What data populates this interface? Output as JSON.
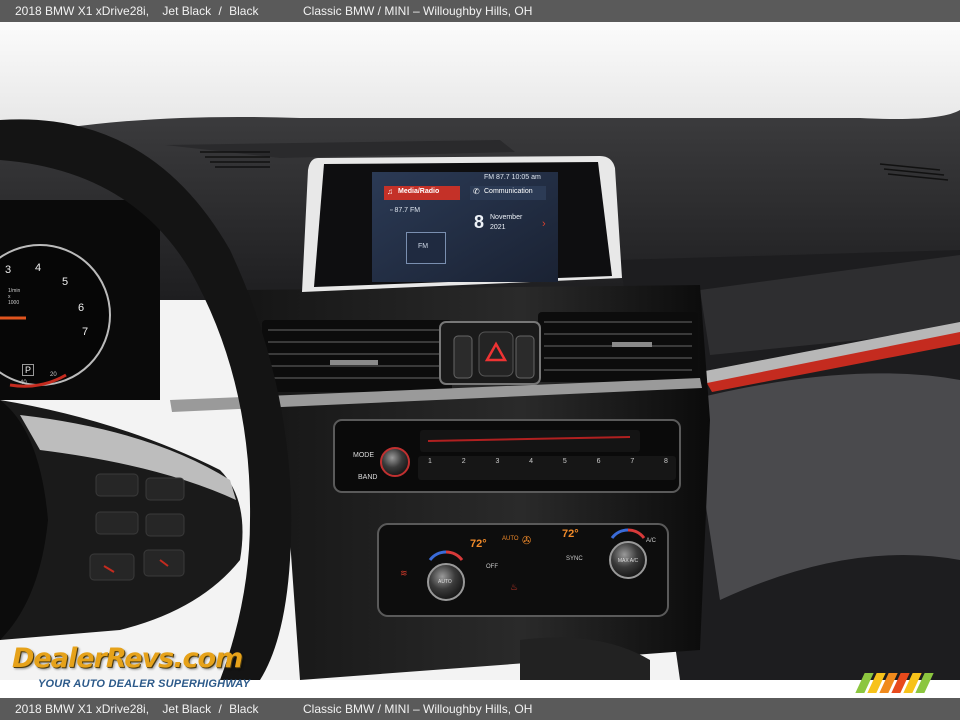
{
  "caption": {
    "model": "2018 BMW X1 xDrive28i,",
    "exterior": "Jet Black",
    "separator": "/",
    "interior": "Black",
    "dealer": "Classic BMW / MINI – Willoughby Hills, OH"
  },
  "watermark": {
    "brand": "DealerRevs.com",
    "tagline": "YOUR AUTO DEALER SUPERHIGHWAY",
    "stripe_colors": [
      "#8cc63f",
      "#f7c21a",
      "#f08a1c",
      "#e84a1c",
      "#f7c21a",
      "#8cc63f"
    ]
  },
  "infotainment": {
    "status": "FM 87.7  10:05 am",
    "media_label": "Media/Radio",
    "station": "87.7 FM",
    "source_button": "FM",
    "communication_label": "Communication",
    "day": "8",
    "month": "November",
    "year": "2021"
  },
  "radio_panel": {
    "mode_label": "MODE",
    "band_label": "BAND",
    "presets": [
      "1",
      "2",
      "3",
      "4",
      "5",
      "6",
      "7",
      "8"
    ]
  },
  "climate_panel": {
    "left_temp": "72°",
    "right_temp": "72°",
    "auto_label": "AUTO",
    "off_label": "OFF",
    "sync_label": "SYNC",
    "ac_label": "A/C",
    "max_ac_label": "MAX A/C",
    "left_knob_label": "AUTO"
  },
  "cluster": {
    "tach_numbers": [
      "3",
      "4",
      "5",
      "6",
      "7"
    ],
    "rpm_unit": "1/min x 1000",
    "gear": "P",
    "temp_scale": [
      "40",
      "20"
    ]
  }
}
